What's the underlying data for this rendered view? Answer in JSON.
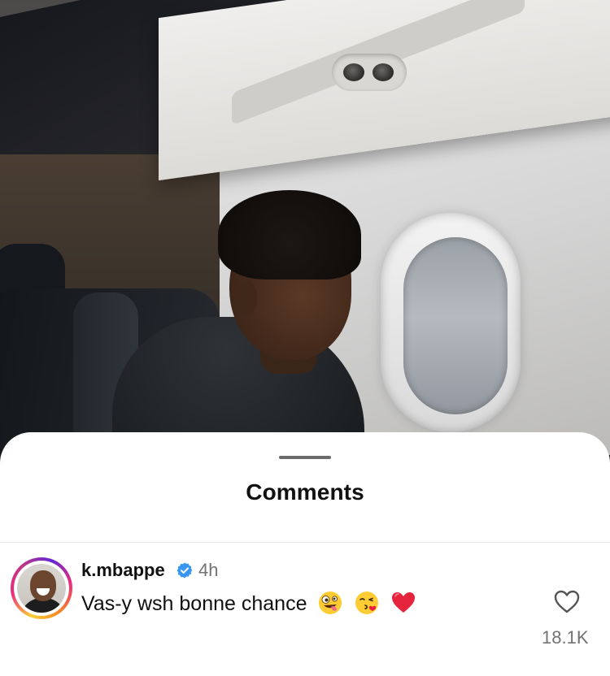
{
  "sheet": {
    "title": "Comments"
  },
  "comment": {
    "username": "k.mbappe",
    "verified": true,
    "timestamp": "4h",
    "text": "Vas-y wsh bonne chance",
    "emojis": [
      "zany-face",
      "face-blowing-kiss",
      "red-heart"
    ],
    "like_count": "18.1K",
    "like_icon": "heart-outline-icon"
  },
  "colors": {
    "verified_badge": "#3797f0",
    "secondary_text": "#737373",
    "primary_text": "#111111"
  }
}
